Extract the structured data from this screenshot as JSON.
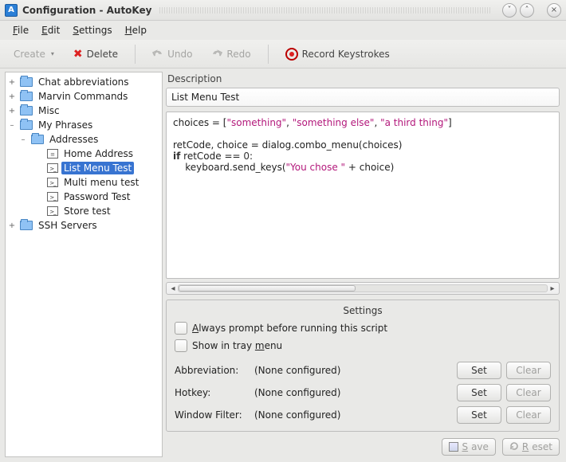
{
  "window": {
    "title": "Configuration - AutoKey"
  },
  "menubar": {
    "file": "File",
    "edit": "Edit",
    "settings": "Settings",
    "help": "Help"
  },
  "toolbar": {
    "create": "Create",
    "delete": "Delete",
    "undo": "Undo",
    "redo": "Redo",
    "record": "Record Keystrokes"
  },
  "tree": {
    "roots": [
      {
        "label": "Chat abbreviations",
        "expander": "+"
      },
      {
        "label": "Marvin Commands",
        "expander": "+"
      },
      {
        "label": "Misc",
        "expander": "+"
      },
      {
        "label": "My Phrases",
        "expander": "–",
        "children": [
          {
            "label": "Addresses",
            "expander": "–",
            "children": [
              {
                "label": "Home Address",
                "icon": "txt"
              },
              {
                "label": "List Menu Test",
                "icon": "script",
                "selected": true
              },
              {
                "label": "Multi menu test",
                "icon": "script"
              },
              {
                "label": "Password Test",
                "icon": "script"
              },
              {
                "label": "Store test",
                "icon": "script"
              }
            ]
          }
        ]
      },
      {
        "label": "SSH Servers",
        "expander": "+"
      }
    ]
  },
  "description": {
    "label": "Description",
    "value": "List Menu Test"
  },
  "code": {
    "l1a": "choices = ",
    "l1b": "[",
    "l1s1": "\"something\"",
    "l1c": ", ",
    "l1s2": "\"something else\"",
    "l1d": ", ",
    "l1s3": "\"a third thing\"",
    "l1e": "]",
    "l2": "",
    "l3": "retCode, choice = dialog.combo_menu(choices)",
    "l4a": "if",
    "l4b": " retCode == ",
    "l4c": "0",
    "l4d": ":",
    "l5a": "    keyboard.send_keys(",
    "l5s": "\"You chose \"",
    "l5b": " + choice)"
  },
  "settings": {
    "heading": "Settings",
    "always_prompt": "Always prompt before running this script",
    "show_tray": "Show in tray menu",
    "abbrev_label": "Abbreviation:",
    "hotkey_label": "Hotkey:",
    "filter_label": "Window Filter:",
    "none": "(None configured)",
    "set": "Set",
    "clear": "Clear"
  },
  "footer": {
    "save": "Save",
    "reset": "Reset"
  }
}
